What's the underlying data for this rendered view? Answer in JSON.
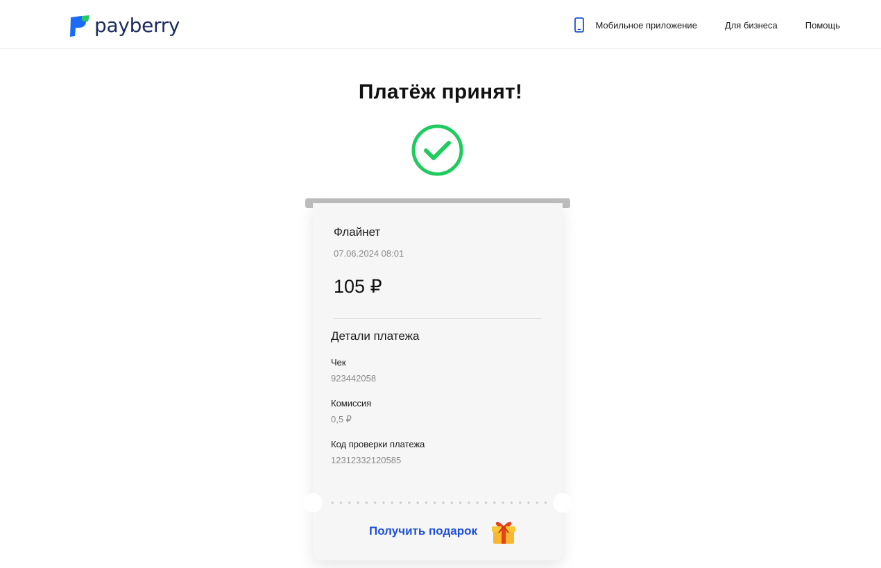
{
  "header": {
    "logo_text": "payberry",
    "nav": [
      {
        "label": "Мобильное приложение",
        "icon": "phone-icon"
      },
      {
        "label": "Для бизнеса"
      },
      {
        "label": "Помощь"
      }
    ]
  },
  "main": {
    "title": "Платёж принят!",
    "status_icon": "check-circle-icon"
  },
  "receipt": {
    "merchant": "Флайнет",
    "datetime": "07.06.2024 08:01",
    "amount": "105 ₽",
    "details_title": "Детали платежа",
    "fields": [
      {
        "label": "Чек",
        "value": "923442058"
      },
      {
        "label": "Комиссия",
        "value": "0,5 ₽"
      },
      {
        "label": "Код проверки платежа",
        "value": "12312332120585"
      }
    ],
    "gift_button": {
      "label": "Получить подарок",
      "icon": "gift-icon"
    }
  },
  "colors": {
    "brand_blue": "#1a6cf5",
    "brand_green": "#27c46a",
    "success_green": "#1ecb5e",
    "link_blue": "#1d4fd8"
  }
}
